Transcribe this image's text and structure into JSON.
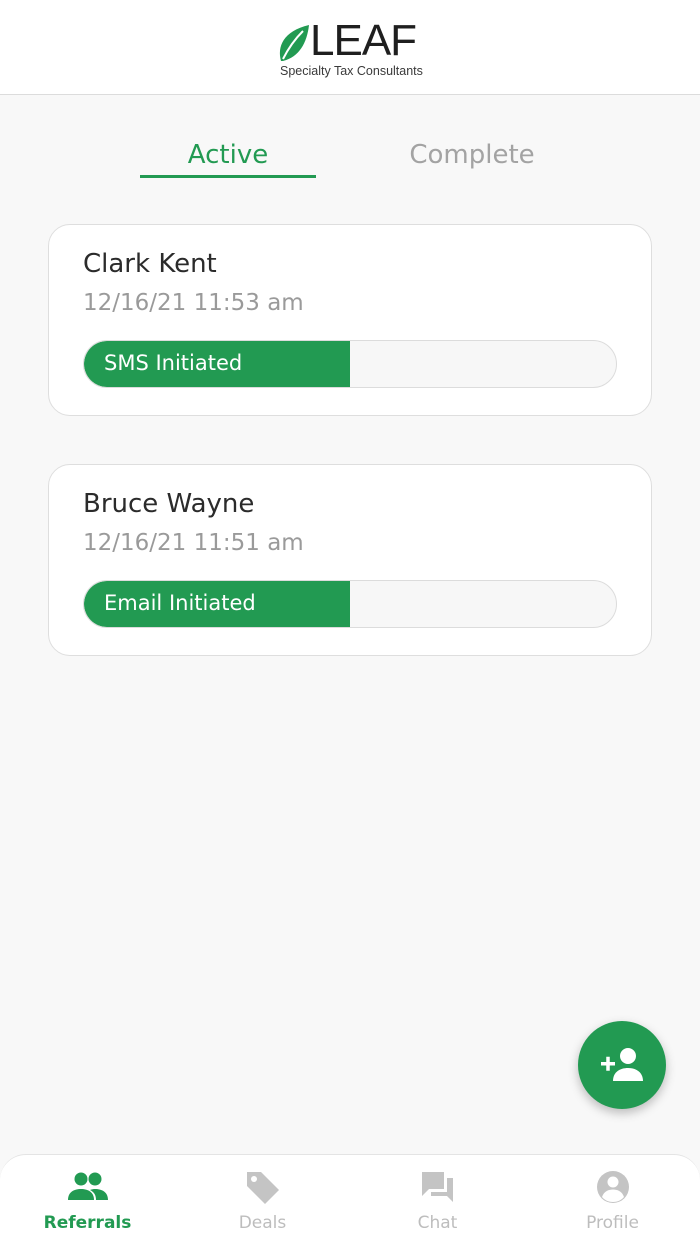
{
  "header": {
    "logo_word": "LEAF",
    "logo_tagline": "Specialty Tax Consultants"
  },
  "tabs": [
    {
      "label": "Active",
      "active": true
    },
    {
      "label": "Complete",
      "active": false
    }
  ],
  "referrals": [
    {
      "name": "Clark Kent",
      "date": "12/16/21 11:53 am",
      "status": "SMS Initiated",
      "progress": 0.5
    },
    {
      "name": "Bruce Wayne",
      "date": "12/16/21 11:51 am",
      "status": "Email Initiated",
      "progress": 0.5
    }
  ],
  "fab": {
    "icon": "add-person-icon"
  },
  "nav": [
    {
      "label": "Referrals",
      "icon": "people-icon",
      "active": true
    },
    {
      "label": "Deals",
      "icon": "tag-icon",
      "active": false
    },
    {
      "label": "Chat",
      "icon": "chat-icon",
      "active": false
    },
    {
      "label": "Profile",
      "icon": "account-circle-icon",
      "active": false
    }
  ],
  "colors": {
    "accent": "#229a52",
    "inactive": "#bdbdbd",
    "background": "#f8f8f8"
  }
}
